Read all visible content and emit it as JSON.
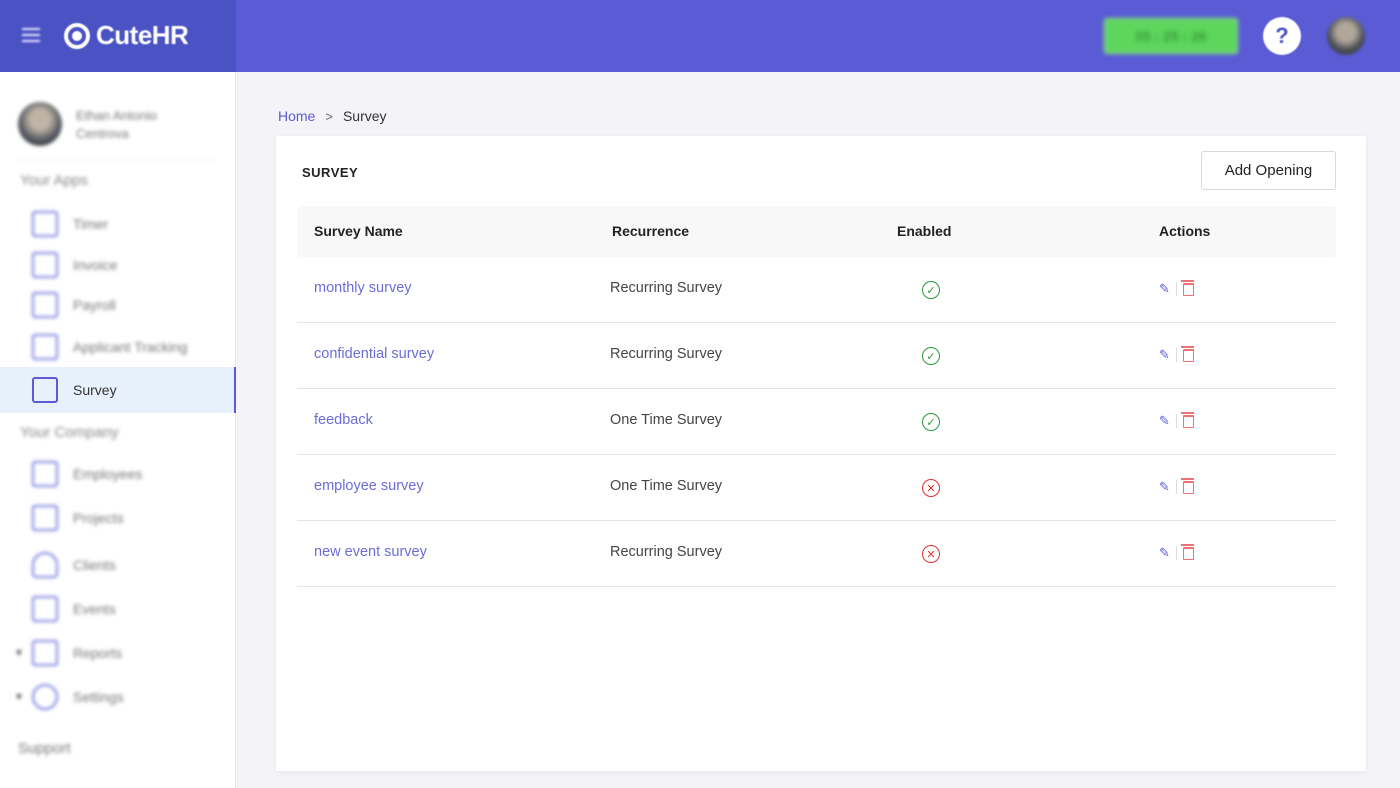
{
  "app": {
    "name": "CuteHR"
  },
  "topbar": {
    "timer": "05 : 25 : 26",
    "help": "?"
  },
  "sidebar": {
    "user_name": "Ethan Antonio Centrova",
    "section_apps": "Your Apps",
    "apps": [
      {
        "label": "Timer",
        "icon": "timer-icon"
      },
      {
        "label": "Invoice",
        "icon": "invoice-icon"
      },
      {
        "label": "Payroll",
        "icon": "payroll-icon"
      },
      {
        "label": "Applicant Tracking",
        "icon": "applicant-tracking-icon"
      },
      {
        "label": "Survey",
        "icon": "survey-icon",
        "active": true
      }
    ],
    "section_company": "Your Company",
    "company": [
      {
        "label": "Employees",
        "icon": "employees-icon"
      },
      {
        "label": "Projects",
        "icon": "projects-icon"
      },
      {
        "label": "Clients",
        "icon": "clients-icon"
      },
      {
        "label": "Events",
        "icon": "events-icon"
      },
      {
        "label": "Reports",
        "icon": "reports-icon",
        "expandable": true
      },
      {
        "label": "Settings",
        "icon": "settings-icon",
        "expandable": true
      }
    ],
    "support": "Support"
  },
  "breadcrumb": {
    "home": "Home",
    "separator": ">",
    "current": "Survey"
  },
  "card": {
    "title": "SURVEY",
    "add_button": "Add Opening",
    "columns": [
      "Survey Name",
      "Recurrence",
      "Enabled",
      "Actions"
    ],
    "rows": [
      {
        "name": "monthly survey",
        "recurrence": "Recurring Survey",
        "enabled": true
      },
      {
        "name": "confidential survey",
        "recurrence": "Recurring Survey",
        "enabled": true
      },
      {
        "name": "feedback",
        "recurrence": "One Time Survey",
        "enabled": true
      },
      {
        "name": "employee survey",
        "recurrence": "One Time Survey",
        "enabled": false
      },
      {
        "name": "new event survey",
        "recurrence": "Recurring Survey",
        "enabled": false
      }
    ]
  },
  "colors": {
    "accent": "#5b5bd6",
    "brand_dark": "#4a52c4",
    "enabled": "#2e9a3a",
    "disabled": "#e53030",
    "delete": "#ec7373"
  }
}
